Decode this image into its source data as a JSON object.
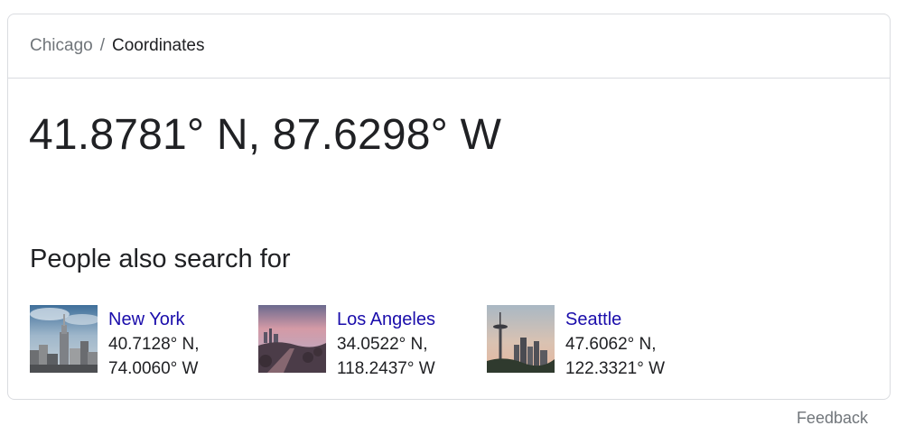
{
  "breadcrumb": {
    "parent": "Chicago",
    "separator": "/",
    "current": "Coordinates"
  },
  "answer": "41.8781° N, 87.6298° W",
  "people_also_search": {
    "title": "People also search for",
    "items": [
      {
        "name": "New York",
        "lat": "40.7128° N,",
        "lng": "74.0060° W",
        "thumbnail": "new-york-skyline-photo"
      },
      {
        "name": "Los Angeles",
        "lat": "34.0522° N,",
        "lng": "118.2437° W",
        "thumbnail": "los-angeles-sunset-photo"
      },
      {
        "name": "Seattle",
        "lat": "47.6062° N,",
        "lng": "122.3321° W",
        "thumbnail": "seattle-space-needle-photo"
      }
    ]
  },
  "feedback_label": "Feedback",
  "colors": {
    "link": "#1a0dab",
    "text": "#202124",
    "muted": "#70757a",
    "border": "#dadce0"
  }
}
